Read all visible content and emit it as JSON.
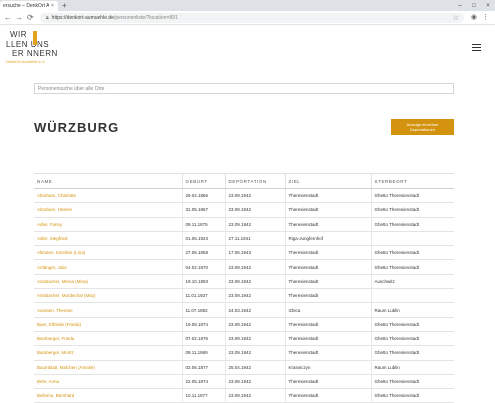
{
  "browser": {
    "tab_title": "ersuche – DenkOrt Aumühl",
    "tab_close": "×",
    "new_tab": "+",
    "url_host": "https://denkort-aumuehle.de",
    "url_path": "/personenliste/?location=891",
    "win_min": "–",
    "win_max": "□",
    "win_close": "×"
  },
  "logo": {
    "line1": "WIR",
    "line2": "LLEN UNS",
    "line3": "ER NNERN",
    "sub": "DenkOrt Aumühle e.V."
  },
  "search": {
    "placeholder": "Personensuche über alle Orte",
    "value": ""
  },
  "page": {
    "title": "WÜRZBURG",
    "action_line1": "Anzeige einzelner",
    "action_line2": "Deportationen"
  },
  "table": {
    "headers": [
      "NAME",
      "GEBURT",
      "DEPORTATION",
      "ZIEL",
      "STERBEORT"
    ],
    "rows": [
      [
        "Abraham, Charlotte",
        "29.04.1866",
        "23.09.1942",
        "Theresienstadt",
        "Ghetto Theresienstadt"
      ],
      [
        "Abraham, Helene",
        "31.05.1867",
        "23.09.1942",
        "Theresienstadt",
        "Ghetto Theresienstadt"
      ],
      [
        "Adler, Fanny",
        "09.11.1875",
        "23.09.1942",
        "Theresienstadt",
        "Ghetto Theresienstadt"
      ],
      [
        "Adler, Siegfried",
        "01.06.1923",
        "27.11.1941",
        "Riga-Jungfernhof",
        ""
      ],
      [
        "Altmann, Karoline (Lina)",
        "27.06.1858",
        "17.06.1943",
        "Theresienstadt",
        "Ghetto Theresienstadt"
      ],
      [
        "Anfänger, Julie",
        "04.02.1870",
        "23.09.1942",
        "Theresienstadt",
        "Ghetto Theresienstadt"
      ],
      [
        "Anisbacher, Minna (Mina)",
        "19.10.1893",
        "23.09.1942",
        "Theresienstadt",
        "Auschwitz"
      ],
      [
        "Anisbacher, Mordechai (Max)",
        "11.01.1927",
        "23.09.1942",
        "Theresienstadt",
        ""
      ],
      [
        "Aumann, Therese",
        "11.07.1882",
        "24.03.1942",
        "Izbica",
        "Raum Lublin"
      ],
      [
        "Baer, Elfriede (Frieda)",
        "19.08.1874",
        "23.09.1942",
        "Theresienstadt",
        "Ghetto Theresienstadt"
      ],
      [
        "Bamberger, Frieda",
        "07.02.1876",
        "23.09.1942",
        "Theresienstadt",
        "Ghetto Theresienstadt"
      ],
      [
        "Bamberger, Moritz",
        "08.11.1869",
        "23.09.1942",
        "Theresienstadt",
        "Ghetto Theresienstadt"
      ],
      [
        "Baumblatt, Malchen (Amalie)",
        "02.06.1877",
        "25.04.1942",
        "Krasniczyn",
        "Raum Lublin"
      ],
      [
        "Behr, Anna",
        "22.05.1874",
        "23.09.1942",
        "Theresienstadt",
        "Ghetto Theresienstadt"
      ],
      [
        "Bellomo, Bernhard",
        "10.11.1877",
        "23.09.1942",
        "Theresienstadt",
        "Ghetto Theresienstadt"
      ]
    ]
  },
  "colors": {
    "accent": "#d4930f",
    "logo_accent": "#e2a219"
  }
}
